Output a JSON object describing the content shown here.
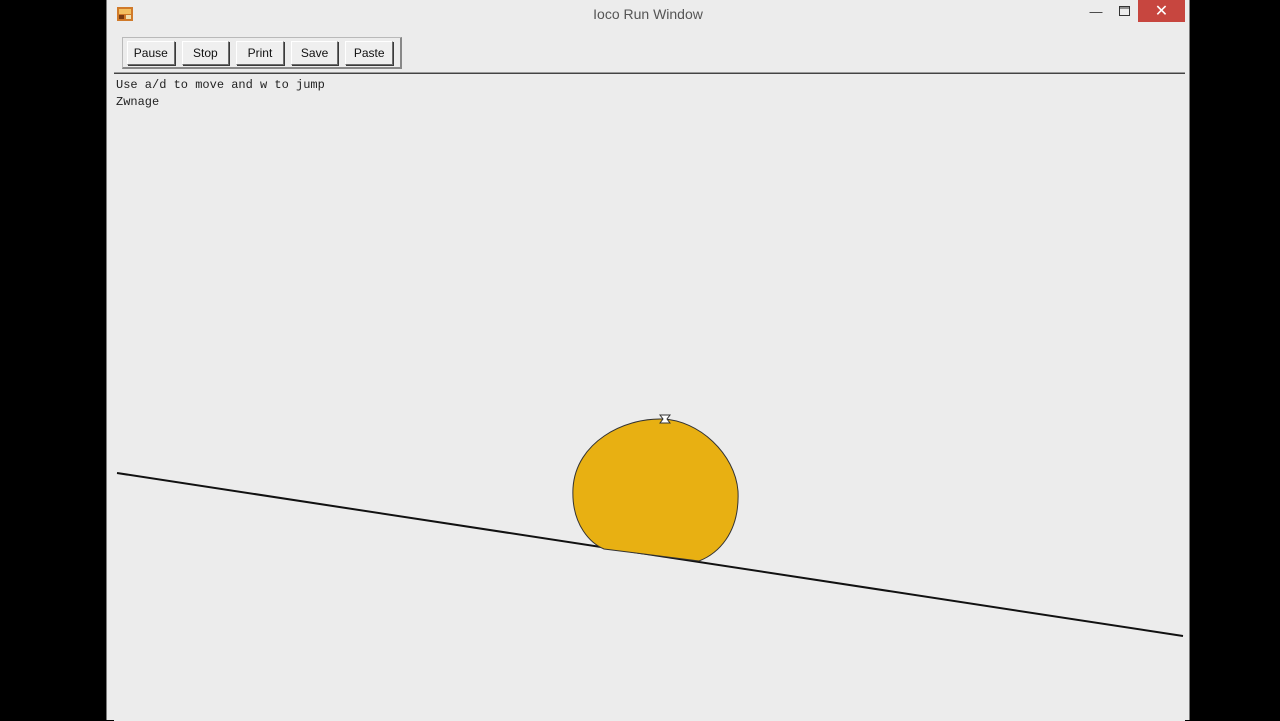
{
  "window": {
    "title": "Ioco Run Window",
    "icon": "app-icon",
    "controls": {
      "minimize_icon": "minimize-icon",
      "maximize_icon": "maximize-icon",
      "close_icon": "close-icon"
    }
  },
  "toolbar": {
    "buttons": [
      {
        "label": "Pause"
      },
      {
        "label": "Stop"
      },
      {
        "label": "Print"
      },
      {
        "label": "Save"
      },
      {
        "label": "Paste"
      }
    ]
  },
  "console": {
    "lines": [
      "Use a/d to move and w to jump",
      "Zwnage"
    ]
  },
  "scene": {
    "ball_color": "#e8b012",
    "ground_color": "#111111",
    "background": "#ececec"
  }
}
